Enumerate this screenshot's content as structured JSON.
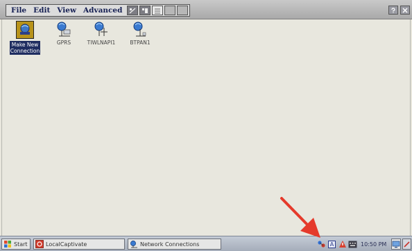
{
  "menu": {
    "items": [
      "File",
      "Edit",
      "View",
      "Advanced"
    ]
  },
  "toolbar": {
    "icons": [
      "large-icons-icon",
      "details-icon",
      "list-icon",
      "blank-button",
      "blank-button"
    ]
  },
  "window_controls": [
    "help-icon",
    "close-icon"
  ],
  "connections": [
    {
      "label_line1": "Make New",
      "label_line2": "Connection",
      "selected": true,
      "icon": "make-new-connection-icon"
    },
    {
      "label_line1": "GPRS",
      "label_line2": "",
      "selected": false,
      "icon": "network-connection-icon"
    },
    {
      "label_line1": "TIWLNAPI1",
      "label_line2": "",
      "selected": false,
      "icon": "network-connection-icon"
    },
    {
      "label_line1": "BTPAN1",
      "label_line2": "",
      "selected": false,
      "icon": "network-connection-icon"
    }
  ],
  "taskbar": {
    "start_label": "Start",
    "tasks": [
      {
        "label": "LocalCaptivate",
        "icon": "localcaptivate-icon"
      },
      {
        "label": "Network Connections",
        "icon": "network-connections-icon"
      }
    ],
    "tray": {
      "icons": [
        "network-status-icon",
        "input-method-icon",
        "alert-icon",
        "keyboard-icon"
      ],
      "input_label": "A",
      "time": "10:50 PM"
    }
  },
  "colors": {
    "background": "#e9e7dd",
    "selection": "#1f2d60",
    "menu_text": "#141e52",
    "arrow": "#e53a2b"
  }
}
